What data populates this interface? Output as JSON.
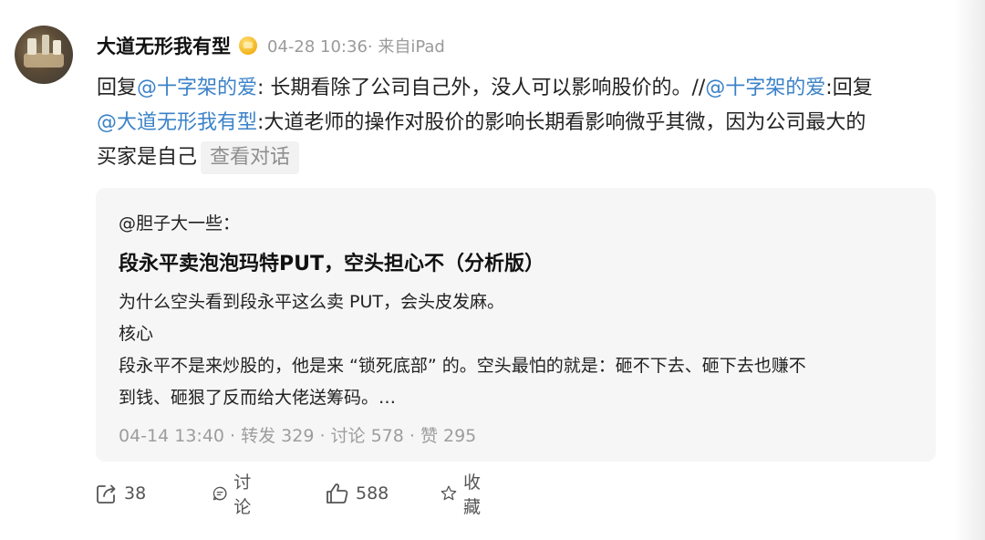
{
  "post": {
    "username": "大道无形我有型",
    "badge_icon": "gold-vip-badge",
    "time_source": "04-28 10:36· 来自iPad",
    "text": {
      "reply_prefix_1": "回复",
      "mention_1": "@十字架的爱",
      "segment_1": ": 长期看除了公司自己外，没人可以影响股价的。//",
      "mention_2": "@十字架的爱",
      "segment_2": ":回复",
      "mention_3": "@大道无形我有型",
      "segment_3": ":大道老师的操作对股价的影响长期看影响微乎其微，因为公司最大的",
      "segment_4": "买家是自己"
    },
    "view_conversation": "查看对话"
  },
  "quoted": {
    "author": "@胆子大一些：",
    "title": "段永平卖泡泡玛特PUT，空头担心不（分析版）",
    "lines": [
      "为什么空头看到段永平这么卖 PUT，会头皮发麻。",
      "核心",
      "段永平不是来炒股的，他是来 “锁死底部” 的。空头最怕的就是：砸不下去、砸下去也赚不",
      "到钱、砸狠了反而给大佬送筹码。…"
    ],
    "meta": "04-14 13:40  · 转发 329 · 讨论 578 · 赞 295"
  },
  "actions": {
    "forward_count": "38",
    "comment_label": "讨论",
    "like_count": "588",
    "favorite_label": "收藏"
  }
}
